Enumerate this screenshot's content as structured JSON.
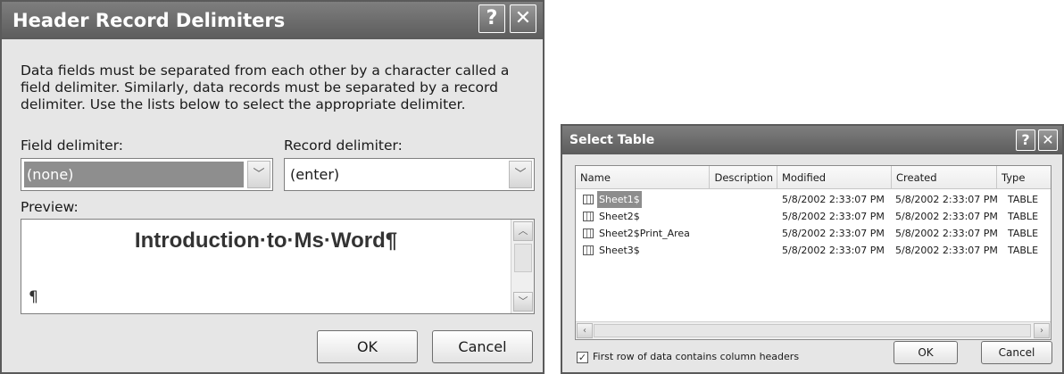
{
  "header_dialog": {
    "title": "Header Record Delimiters",
    "help_button": "?",
    "close_button": "✕",
    "description": "Data fields must be separated from each other by a character called a field delimiter. Similarly, data records must be separated by a record delimiter.  Use the lists below to select the appropriate delimiter.",
    "field_delimiter_label": "Field delimiter:",
    "field_delimiter_value": "(none)",
    "record_delimiter_label": "Record delimiter:",
    "record_delimiter_value": "(enter)",
    "preview_label": "Preview:",
    "preview_title": "Introduction·to·Ms·Word¶",
    "preview_mark": "¶",
    "ok_label": "OK",
    "cancel_label": "Cancel"
  },
  "select_table": {
    "title": "Select Table",
    "help_button": "?",
    "close_button": "✕",
    "columns": [
      "Name",
      "Description",
      "Modified",
      "Created",
      "Type"
    ],
    "rows": [
      {
        "name": "Sheet1$",
        "description": "",
        "modified": "5/8/2002 2:33:07 PM",
        "created": "5/8/2002 2:33:07 PM",
        "type": "TABLE",
        "selected": true
      },
      {
        "name": "Sheet2$",
        "description": "",
        "modified": "5/8/2002 2:33:07 PM",
        "created": "5/8/2002 2:33:07 PM",
        "type": "TABLE",
        "selected": false
      },
      {
        "name": "Sheet2$Print_Area",
        "description": "",
        "modified": "5/8/2002 2:33:07 PM",
        "created": "5/8/2002 2:33:07 PM",
        "type": "TABLE",
        "selected": false
      },
      {
        "name": "Sheet3$",
        "description": "",
        "modified": "5/8/2002 2:33:07 PM",
        "created": "5/8/2002 2:33:07 PM",
        "type": "TABLE",
        "selected": false
      }
    ],
    "checkbox_label": "First row of data contains column headers",
    "checkbox_checked": true,
    "checkbox_mark": "✓",
    "ok_label": "OK",
    "cancel_label": "Cancel"
  },
  "icons": {
    "dropdown_arrow": "﹀",
    "scroll_up": "︿",
    "scroll_down": "﹀",
    "scroll_left": "‹",
    "scroll_right": "›"
  }
}
